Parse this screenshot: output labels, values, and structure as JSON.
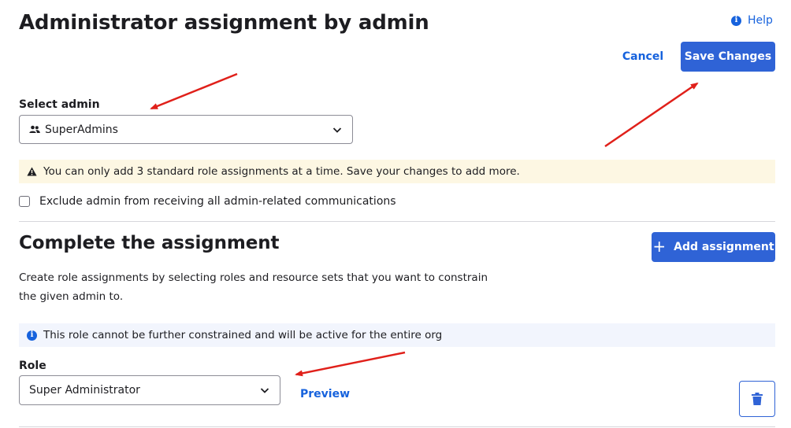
{
  "header": {
    "title": "Administrator assignment by admin",
    "help_label": "Help",
    "help_icon": "info-icon"
  },
  "actions": {
    "cancel_label": "Cancel",
    "save_label": "Save Changes"
  },
  "select_admin": {
    "label": "Select admin",
    "value": "SuperAdmins",
    "icon": "group-icon"
  },
  "warning": {
    "icon": "warning-icon",
    "text": "You can only add 3 standard role assignments at a time. Save your changes to add more."
  },
  "exclude_checkbox": {
    "label": "Exclude admin from receiving all admin-related communications",
    "checked": false
  },
  "assignment": {
    "title": "Complete the assignment",
    "add_label": "Add assignment",
    "description": "Create role assignments by selecting roles and resource sets that you want to constrain the given admin to.",
    "info_text": "This role cannot be further constrained and will be active for the entire org",
    "role_label": "Role",
    "role_value": "Super Administrator",
    "preview_label": "Preview",
    "delete_icon": "trash-icon"
  },
  "colors": {
    "primary": "#2f63d6",
    "link": "#1662dd",
    "warning_bg": "#fdf7e3",
    "info_bg": "#f2f5fd",
    "annotation_arrow": "#e0201a"
  }
}
